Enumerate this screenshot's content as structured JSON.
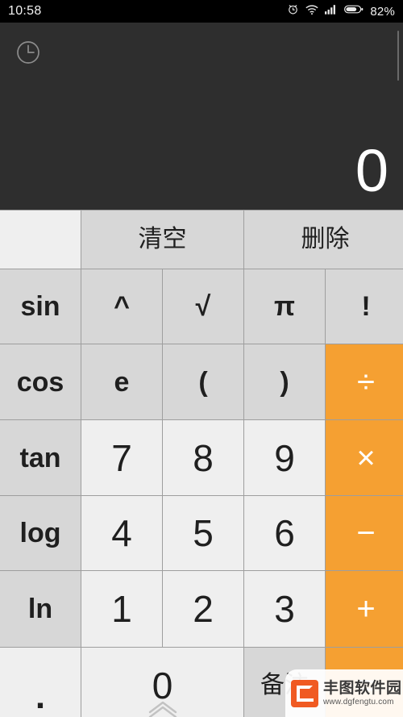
{
  "status_bar": {
    "time": "10:58",
    "battery_percent": "82%",
    "icons": [
      "alarm-icon",
      "wifi-icon",
      "signal-icon",
      "battery-icon"
    ]
  },
  "display": {
    "history_icon": "history-clock-icon",
    "expression": "",
    "result": "0",
    "background_color": "#2e2e2e",
    "text_color": "#ffffff"
  },
  "colors": {
    "accent": "#f5a032",
    "function_key": "#d7d7d7",
    "number_key": "#efefef",
    "grid_line": "#9e9e9e",
    "status_bar": "#000000"
  },
  "keypad": {
    "rows": [
      {
        "keys": [
          {
            "label": "",
            "name": "key-blank",
            "style": "blank",
            "span": 1,
            "interactable": false
          },
          {
            "label": "清空",
            "name": "key-clear",
            "style": "cjk",
            "span": 2,
            "interactable": true
          },
          {
            "label": "删除",
            "name": "key-delete",
            "style": "cjk",
            "span": 2,
            "interactable": true
          }
        ]
      },
      {
        "keys": [
          {
            "label": "sin",
            "name": "key-sin",
            "style": "func",
            "span": 1,
            "interactable": true
          },
          {
            "label": "^",
            "name": "key-power",
            "style": "func",
            "span": 1,
            "interactable": true
          },
          {
            "label": "√",
            "name": "key-sqrt",
            "style": "func",
            "span": 1,
            "interactable": true
          },
          {
            "label": "π",
            "name": "key-pi",
            "style": "func",
            "span": 1,
            "interactable": true
          },
          {
            "label": "!",
            "name": "key-factorial",
            "style": "func",
            "span": 1,
            "interactable": true
          }
        ]
      },
      {
        "keys": [
          {
            "label": "cos",
            "name": "key-cos",
            "style": "func",
            "span": 1,
            "interactable": true
          },
          {
            "label": "e",
            "name": "key-e",
            "style": "func",
            "span": 1,
            "interactable": true
          },
          {
            "label": "(",
            "name": "key-paren-open",
            "style": "func",
            "span": 1,
            "interactable": true
          },
          {
            "label": ")",
            "name": "key-paren-close",
            "style": "func",
            "span": 1,
            "interactable": true
          },
          {
            "label": "÷",
            "name": "key-divide",
            "style": "accent",
            "span": 1,
            "interactable": true
          }
        ]
      },
      {
        "keys": [
          {
            "label": "tan",
            "name": "key-tan",
            "style": "func",
            "span": 1,
            "interactable": true
          },
          {
            "label": "7",
            "name": "key-7",
            "style": "num",
            "span": 1,
            "interactable": true
          },
          {
            "label": "8",
            "name": "key-8",
            "style": "num",
            "span": 1,
            "interactable": true
          },
          {
            "label": "9",
            "name": "key-9",
            "style": "num",
            "span": 1,
            "interactable": true
          },
          {
            "label": "×",
            "name": "key-multiply",
            "style": "accent",
            "span": 1,
            "interactable": true
          }
        ]
      },
      {
        "keys": [
          {
            "label": "log",
            "name": "key-log",
            "style": "func",
            "span": 1,
            "interactable": true
          },
          {
            "label": "4",
            "name": "key-4",
            "style": "num",
            "span": 1,
            "interactable": true
          },
          {
            "label": "5",
            "name": "key-5",
            "style": "num",
            "span": 1,
            "interactable": true
          },
          {
            "label": "6",
            "name": "key-6",
            "style": "num",
            "span": 1,
            "interactable": true
          },
          {
            "label": "−",
            "name": "key-minus",
            "style": "accent",
            "span": 1,
            "interactable": true
          }
        ]
      },
      {
        "keys": [
          {
            "label": "ln",
            "name": "key-ln",
            "style": "func",
            "span": 1,
            "interactable": true
          },
          {
            "label": "1",
            "name": "key-1",
            "style": "num",
            "span": 1,
            "interactable": true
          },
          {
            "label": "2",
            "name": "key-2",
            "style": "num",
            "span": 1,
            "interactable": true
          },
          {
            "label": "3",
            "name": "key-3",
            "style": "num",
            "span": 1,
            "interactable": true
          },
          {
            "label": "+",
            "name": "key-plus",
            "style": "accent",
            "span": 1,
            "interactable": true
          }
        ]
      },
      {
        "keys": [
          {
            "label": ".",
            "name": "key-decimal",
            "style": "dot",
            "span": 1,
            "interactable": true
          },
          {
            "label": "0",
            "name": "key-0",
            "style": "num",
            "span": 2,
            "interactable": true
          },
          {
            "label": "备注",
            "name": "key-notes",
            "style": "cjk",
            "span": 1,
            "interactable": true
          },
          {
            "label": "=",
            "name": "key-equals",
            "style": "accent",
            "span": 1,
            "interactable": true
          }
        ]
      }
    ],
    "drag_handle_icon": "chevron-up-icon"
  },
  "watermark": {
    "name": "丰图软件园",
    "url": "www.dgfengtu.com",
    "logo_icon": "fengtu-logo-icon"
  }
}
